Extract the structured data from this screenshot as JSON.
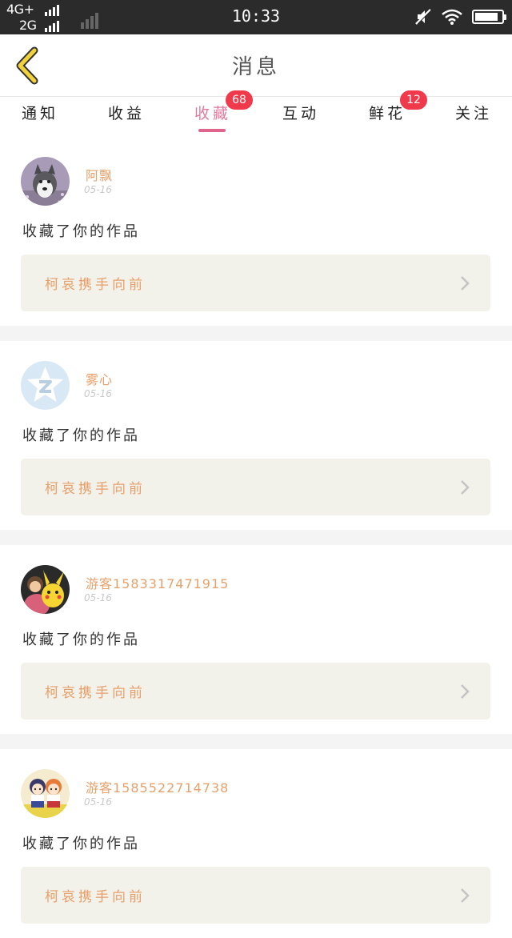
{
  "status_bar": {
    "network_line1": "4G+",
    "network_line2": "2G",
    "time": "10:33",
    "icons": [
      "signal-icon",
      "mute-icon",
      "wifi-icon",
      "battery-icon"
    ]
  },
  "header": {
    "title": "消息",
    "back_icon": "chevron-left-icon"
  },
  "tabs": [
    {
      "label": "通知",
      "active": false,
      "badge": ""
    },
    {
      "label": "收益",
      "active": false,
      "badge": ""
    },
    {
      "label": "收藏",
      "active": true,
      "badge": "68"
    },
    {
      "label": "互动",
      "active": false,
      "badge": ""
    },
    {
      "label": "鲜花",
      "active": false,
      "badge": "12"
    },
    {
      "label": "关注",
      "active": false,
      "badge": ""
    }
  ],
  "feed": [
    {
      "user": "阿飘",
      "date": "05-16",
      "action": "收藏了你的作品",
      "work_title": "柯哀携手向前",
      "avatar": "husky-dog"
    },
    {
      "user": "雾心",
      "date": "05-16",
      "action": "收藏了你的作品",
      "work_title": "柯哀携手向前",
      "avatar": "default-star"
    },
    {
      "user": "游客1583317471915",
      "date": "05-16",
      "action": "收藏了你的作品",
      "work_title": "柯哀携手向前",
      "avatar": "child-pikachu"
    },
    {
      "user": "游客1585522714738",
      "date": "05-16",
      "action": "收藏了你的作品",
      "work_title": "柯哀携手向前",
      "avatar": "anime-characters"
    }
  ],
  "colors": {
    "accent_pink": "#e07a9e",
    "badge_red": "#f0394a",
    "name_orange": "#e8a06a",
    "back_yellow": "#f2d23a",
    "card_bg": "#f2f1ea"
  }
}
